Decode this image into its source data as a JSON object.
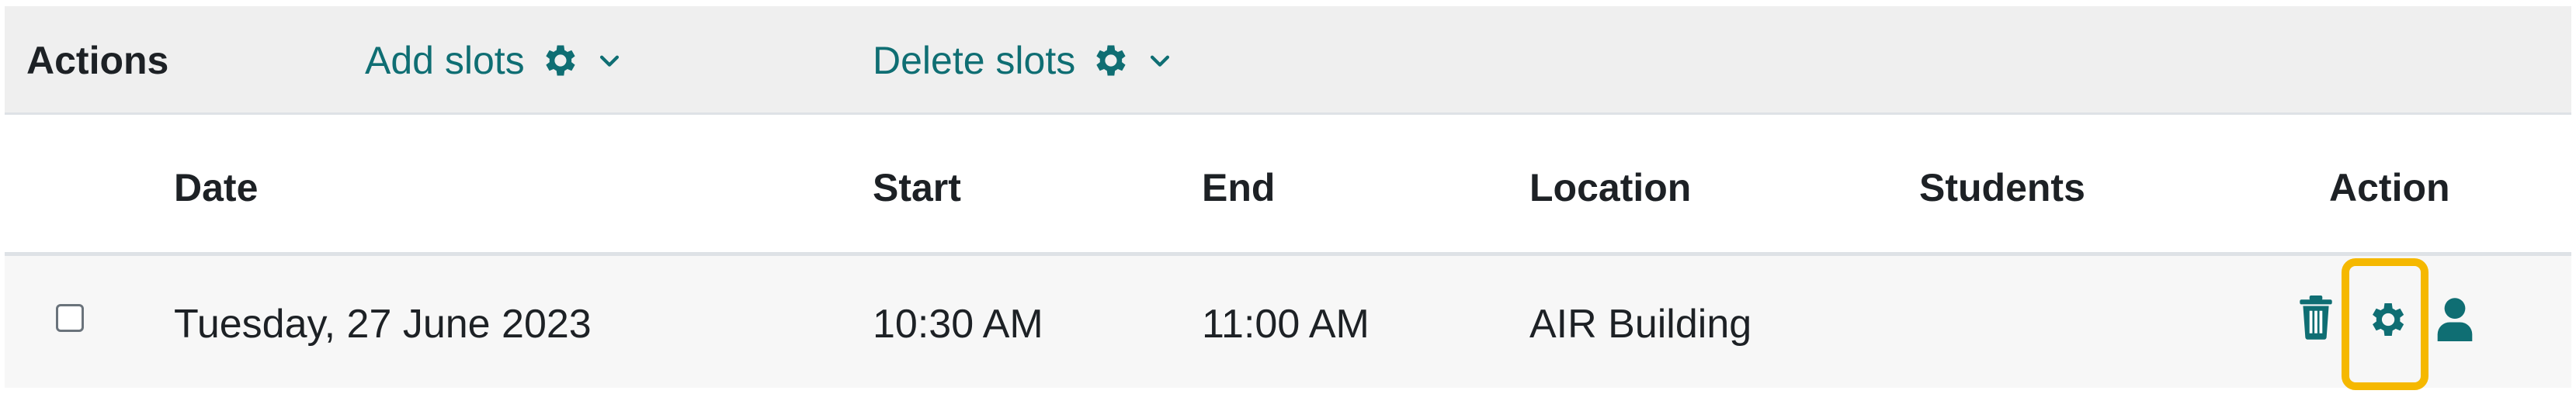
{
  "actions_bar": {
    "label": "Actions",
    "add_slots": {
      "label": "Add slots",
      "icon": "gear-icon"
    },
    "delete_slots": {
      "label": "Delete slots",
      "icon": "gear-icon"
    }
  },
  "table": {
    "headers": {
      "select": "",
      "date": "Date",
      "start": "Start",
      "end": "End",
      "location": "Location",
      "students": "Students",
      "action": "Action"
    },
    "rows": [
      {
        "date": "Tuesday, 27 June 2023",
        "start": "10:30 AM",
        "end": "11:00 AM",
        "location": "AIR Building",
        "students": "",
        "actions": [
          "trash-icon",
          "gear-icon",
          "person-icon"
        ]
      }
    ]
  },
  "colors": {
    "accent": "#0f6e73",
    "highlight": "#f5b800",
    "bar_bg": "#efefef",
    "row_bg": "#f7f7f7"
  }
}
